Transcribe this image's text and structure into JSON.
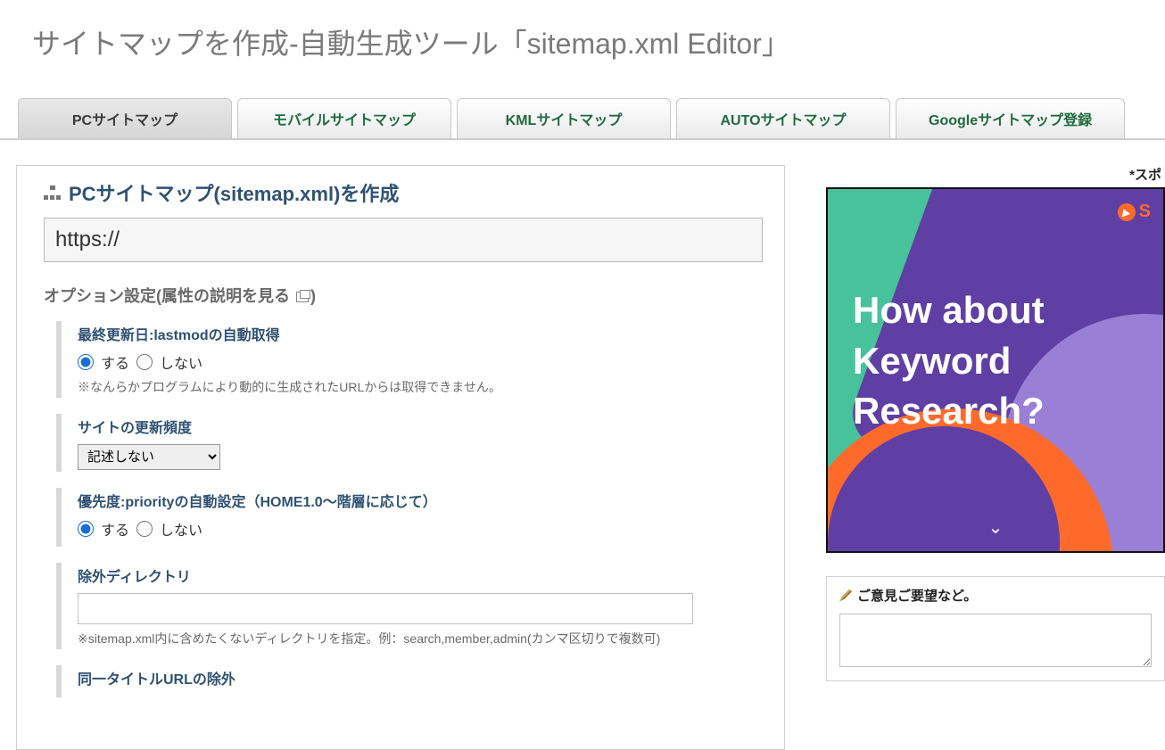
{
  "page_title": "サイトマップを作成-自動生成ツール「sitemap.xml Editor」",
  "tabs": [
    {
      "label": "PCサイトマップ",
      "active": true
    },
    {
      "label": "モバイルサイトマップ",
      "active": false
    },
    {
      "label": "KMLサイトマップ",
      "active": false
    },
    {
      "label": "AUTOサイトマップ",
      "active": false
    },
    {
      "label": "Googleサイトマップ登録",
      "active": false
    }
  ],
  "section_heading": "PCサイトマップ(sitemap.xml)を作成",
  "url_value": "https://",
  "options_heading_prefix": "オプション設定(",
  "options_heading_link": "属性の説明を見る",
  "options_heading_suffix": ")",
  "opt_lastmod": {
    "title": "最終更新日:lastmodの自動取得",
    "radio_yes": "する",
    "radio_no": "しない",
    "note": "※なんらかプログラムにより動的に生成されたURLからは取得できません。"
  },
  "opt_freq": {
    "title": "サイトの更新頻度",
    "selected": "記述しない"
  },
  "opt_priority": {
    "title": "優先度:priorityの自動設定（HOME1.0〜階層に応じて）",
    "radio_yes": "する",
    "radio_no": "しない"
  },
  "opt_exclude": {
    "title": "除外ディレクトリ",
    "value": "",
    "note": "※sitemap.xml内に含めたくないディレクトリを指定。例：search,member,admin(カンマ区切りで複数可)"
  },
  "opt_sametitle": {
    "title": "同一タイトルURLの除外"
  },
  "sponsor_label": "*スポ",
  "ad": {
    "headline_l1": "How about",
    "headline_l2": "Keyword",
    "headline_l3": "Research?",
    "brand_letter": "S"
  },
  "feedback_heading": "ご意見ご要望など。"
}
